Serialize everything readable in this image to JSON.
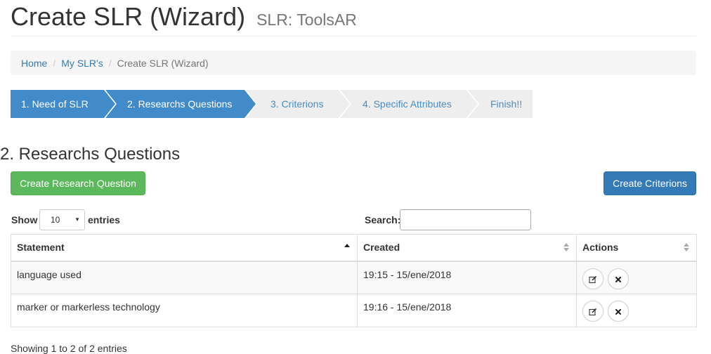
{
  "header": {
    "title": "Create SLR (Wizard)",
    "subtitle": "SLR: ToolsAR"
  },
  "breadcrumb": {
    "items": [
      "Home",
      "My SLR's"
    ],
    "active": "Create SLR (Wizard)"
  },
  "wizard": {
    "steps": [
      {
        "label": "1. Need of SLR",
        "state": "done"
      },
      {
        "label": "2. Researchs Questions",
        "state": "current"
      },
      {
        "label": "3. Criterions",
        "state": "todo"
      },
      {
        "label": "4. Specific Attributes",
        "state": "todo"
      },
      {
        "label": "Finish!!",
        "state": "todo"
      }
    ],
    "colors": {
      "active": "#428bca",
      "inactive": "#eeeeee"
    }
  },
  "section": {
    "title": "2. Researchs Questions"
  },
  "buttons": {
    "create_question": "Create Research Question",
    "create_criterions": "Create Criterions"
  },
  "table_controls": {
    "show_label": "Show",
    "page_length": "10",
    "entries_label": "entries",
    "search_label": "Search:",
    "search_value": ""
  },
  "table": {
    "columns": [
      "Statement",
      "Created",
      "Actions"
    ],
    "rows": [
      {
        "statement": "language used",
        "created": "19:15 - 15/ene/2018",
        "actions": [
          "edit-icon",
          "delete-icon"
        ]
      },
      {
        "statement": "marker or markerless technology",
        "created": "19:16 - 15/ene/2018",
        "actions": [
          "edit-icon",
          "delete-icon"
        ]
      }
    ]
  },
  "info": "Showing 1 to 2 of 2 entries"
}
